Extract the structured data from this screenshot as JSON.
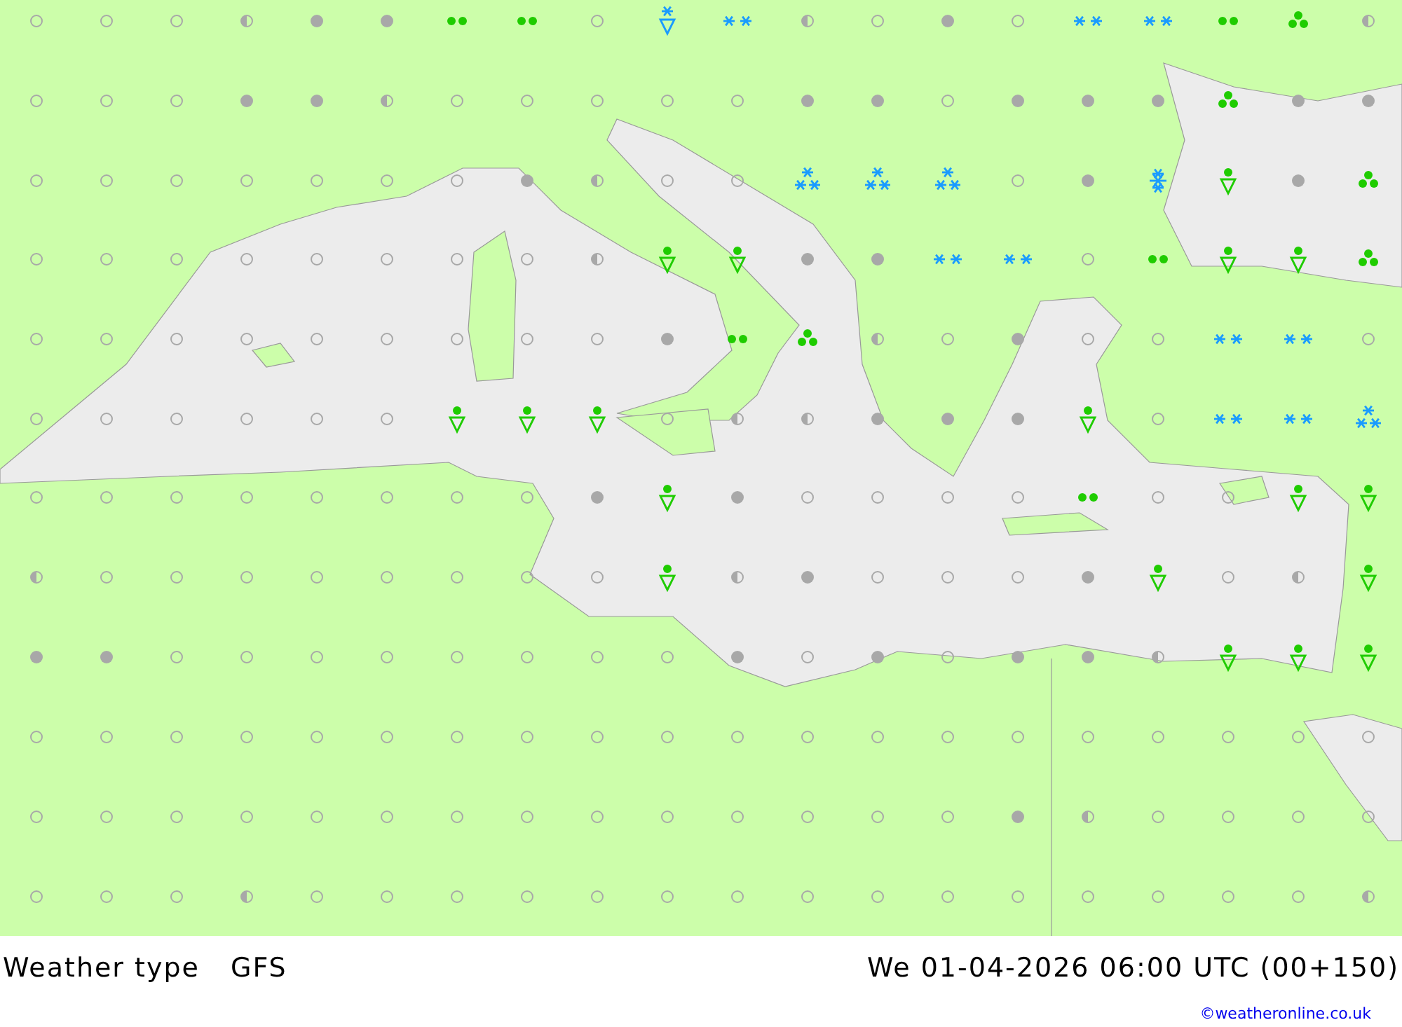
{
  "map": {
    "symbol_rows": [
      [
        {
          "kind": "clear"
        },
        {
          "kind": "clear"
        },
        {
          "kind": "clear"
        },
        {
          "kind": "half"
        },
        {
          "kind": "grey"
        },
        {
          "kind": "grey"
        },
        {
          "kind": "rain"
        },
        {
          "kind": "rain"
        },
        {
          "kind": "clear"
        },
        {
          "kind": "snowshower"
        },
        {
          "kind": "snow"
        },
        {
          "kind": "half"
        },
        {
          "kind": "clear"
        },
        {
          "kind": "grey"
        },
        {
          "kind": "clear"
        },
        {
          "kind": "snow"
        },
        {
          "kind": "snow"
        },
        {
          "kind": "rain"
        },
        {
          "kind": "showers"
        },
        {
          "kind": "half"
        }
      ],
      [
        {
          "kind": "clear"
        },
        {
          "kind": "clear"
        },
        {
          "kind": "clear"
        },
        {
          "kind": "grey"
        },
        {
          "kind": "grey"
        },
        {
          "kind": "half"
        },
        {
          "kind": "clear"
        },
        {
          "kind": "clear"
        },
        {
          "kind": "clear"
        },
        {
          "kind": "clear"
        },
        {
          "kind": "clear"
        },
        {
          "kind": "grey"
        },
        {
          "kind": "grey"
        },
        {
          "kind": "clear"
        },
        {
          "kind": "grey"
        },
        {
          "kind": "grey"
        },
        {
          "kind": "grey"
        },
        {
          "kind": "showers"
        },
        {
          "kind": "grey"
        },
        {
          "kind": "grey"
        }
      ],
      [
        {
          "kind": "clear"
        },
        {
          "kind": "clear"
        },
        {
          "kind": "clear"
        },
        {
          "kind": "clear"
        },
        {
          "kind": "clear"
        },
        {
          "kind": "clear"
        },
        {
          "kind": "clear"
        },
        {
          "kind": "grey"
        },
        {
          "kind": "half"
        },
        {
          "kind": "clear"
        },
        {
          "kind": "clear"
        },
        {
          "kind": "heavysnow"
        },
        {
          "kind": "heavysnow"
        },
        {
          "kind": "heavysnow"
        },
        {
          "kind": "clear"
        },
        {
          "kind": "grey"
        },
        {
          "kind": "snowstorm"
        },
        {
          "kind": "rainshower"
        },
        {
          "kind": "grey"
        },
        {
          "kind": "showers"
        }
      ],
      [
        {
          "kind": "clear"
        },
        {
          "kind": "clear"
        },
        {
          "kind": "clear"
        },
        {
          "kind": "clear"
        },
        {
          "kind": "clear"
        },
        {
          "kind": "clear"
        },
        {
          "kind": "clear"
        },
        {
          "kind": "clear"
        },
        {
          "kind": "half"
        },
        {
          "kind": "rainshower"
        },
        {
          "kind": "rainshower"
        },
        {
          "kind": "grey"
        },
        {
          "kind": "grey"
        },
        {
          "kind": "snow"
        },
        {
          "kind": "snow"
        },
        {
          "kind": "clear"
        },
        {
          "kind": "rain"
        },
        {
          "kind": "rainshower"
        },
        {
          "kind": "rainshower"
        },
        {
          "kind": "showers"
        }
      ],
      [
        {
          "kind": "clear"
        },
        {
          "kind": "clear"
        },
        {
          "kind": "clear"
        },
        {
          "kind": "clear"
        },
        {
          "kind": "clear"
        },
        {
          "kind": "clear"
        },
        {
          "kind": "clear"
        },
        {
          "kind": "clear"
        },
        {
          "kind": "clear"
        },
        {
          "kind": "grey"
        },
        {
          "kind": "rain"
        },
        {
          "kind": "showers"
        },
        {
          "kind": "half"
        },
        {
          "kind": "clear"
        },
        {
          "kind": "grey"
        },
        {
          "kind": "clear"
        },
        {
          "kind": "clear"
        },
        {
          "kind": "snow"
        },
        {
          "kind": "snow"
        },
        {
          "kind": "clear"
        }
      ],
      [
        {
          "kind": "clear"
        },
        {
          "kind": "clear"
        },
        {
          "kind": "clear"
        },
        {
          "kind": "clear"
        },
        {
          "kind": "clear"
        },
        {
          "kind": "clear"
        },
        {
          "kind": "rainshower"
        },
        {
          "kind": "rainshower"
        },
        {
          "kind": "rainshower"
        },
        {
          "kind": "clear"
        },
        {
          "kind": "half"
        },
        {
          "kind": "half"
        },
        {
          "kind": "grey"
        },
        {
          "kind": "grey"
        },
        {
          "kind": "grey"
        },
        {
          "kind": "rainshower"
        },
        {
          "kind": "clear"
        },
        {
          "kind": "snow"
        },
        {
          "kind": "snow"
        },
        {
          "kind": "heavysnow"
        }
      ],
      [
        {
          "kind": "clear"
        },
        {
          "kind": "clear"
        },
        {
          "kind": "clear"
        },
        {
          "kind": "clear"
        },
        {
          "kind": "clear"
        },
        {
          "kind": "clear"
        },
        {
          "kind": "clear"
        },
        {
          "kind": "clear"
        },
        {
          "kind": "grey"
        },
        {
          "kind": "rainshower"
        },
        {
          "kind": "grey"
        },
        {
          "kind": "clear"
        },
        {
          "kind": "clear"
        },
        {
          "kind": "clear"
        },
        {
          "kind": "clear"
        },
        {
          "kind": "rain"
        },
        {
          "kind": "clear"
        },
        {
          "kind": "clear"
        },
        {
          "kind": "rainshower"
        },
        {
          "kind": "rainshower"
        }
      ],
      [
        {
          "kind": "half"
        },
        {
          "kind": "clear"
        },
        {
          "kind": "clear"
        },
        {
          "kind": "clear"
        },
        {
          "kind": "clear"
        },
        {
          "kind": "clear"
        },
        {
          "kind": "clear"
        },
        {
          "kind": "clear"
        },
        {
          "kind": "clear"
        },
        {
          "kind": "rainshower"
        },
        {
          "kind": "half"
        },
        {
          "kind": "grey"
        },
        {
          "kind": "clear"
        },
        {
          "kind": "clear"
        },
        {
          "kind": "clear"
        },
        {
          "kind": "grey"
        },
        {
          "kind": "rainshower"
        },
        {
          "kind": "clear"
        },
        {
          "kind": "half"
        },
        {
          "kind": "rainshower"
        }
      ],
      [
        {
          "kind": "grey"
        },
        {
          "kind": "grey"
        },
        {
          "kind": "clear"
        },
        {
          "kind": "clear"
        },
        {
          "kind": "clear"
        },
        {
          "kind": "clear"
        },
        {
          "kind": "clear"
        },
        {
          "kind": "clear"
        },
        {
          "kind": "clear"
        },
        {
          "kind": "clear"
        },
        {
          "kind": "grey"
        },
        {
          "kind": "clear"
        },
        {
          "kind": "grey"
        },
        {
          "kind": "clear"
        },
        {
          "kind": "grey"
        },
        {
          "kind": "grey"
        },
        {
          "kind": "half"
        },
        {
          "kind": "rainshower"
        },
        {
          "kind": "rainshower"
        },
        {
          "kind": "rainshower"
        }
      ],
      [
        {
          "kind": "clear"
        },
        {
          "kind": "clear"
        },
        {
          "kind": "clear"
        },
        {
          "kind": "clear"
        },
        {
          "kind": "clear"
        },
        {
          "kind": "clear"
        },
        {
          "kind": "clear"
        },
        {
          "kind": "clear"
        },
        {
          "kind": "clear"
        },
        {
          "kind": "clear"
        },
        {
          "kind": "clear"
        },
        {
          "kind": "clear"
        },
        {
          "kind": "clear"
        },
        {
          "kind": "clear"
        },
        {
          "kind": "clear"
        },
        {
          "kind": "clear"
        },
        {
          "kind": "clear"
        },
        {
          "kind": "clear"
        },
        {
          "kind": "clear"
        },
        {
          "kind": "clear"
        }
      ],
      [
        {
          "kind": "clear"
        },
        {
          "kind": "clear"
        },
        {
          "kind": "clear"
        },
        {
          "kind": "clear"
        },
        {
          "kind": "clear"
        },
        {
          "kind": "clear"
        },
        {
          "kind": "clear"
        },
        {
          "kind": "clear"
        },
        {
          "kind": "clear"
        },
        {
          "kind": "clear"
        },
        {
          "kind": "clear"
        },
        {
          "kind": "clear"
        },
        {
          "kind": "clear"
        },
        {
          "kind": "clear"
        },
        {
          "kind": "grey"
        },
        {
          "kind": "half"
        },
        {
          "kind": "clear"
        },
        {
          "kind": "clear"
        },
        {
          "kind": "clear"
        },
        {
          "kind": "clear"
        }
      ],
      [
        {
          "kind": "clear"
        },
        {
          "kind": "clear"
        },
        {
          "kind": "clear"
        },
        {
          "kind": "half"
        },
        {
          "kind": "clear"
        },
        {
          "kind": "clear"
        },
        {
          "kind": "clear"
        },
        {
          "kind": "clear"
        },
        {
          "kind": "clear"
        },
        {
          "kind": "clear"
        },
        {
          "kind": "clear"
        },
        {
          "kind": "clear"
        },
        {
          "kind": "clear"
        },
        {
          "kind": "clear"
        },
        {
          "kind": "clear"
        },
        {
          "kind": "clear"
        },
        {
          "kind": "clear"
        },
        {
          "kind": "clear"
        },
        {
          "kind": "clear"
        },
        {
          "kind": "half"
        }
      ]
    ]
  },
  "footer": {
    "title": "Weather type",
    "model": "GFS",
    "valid_time": "We 01-04-2026 06:00 UTC (00+150)",
    "credit": "©weatheronline.co.uk"
  }
}
